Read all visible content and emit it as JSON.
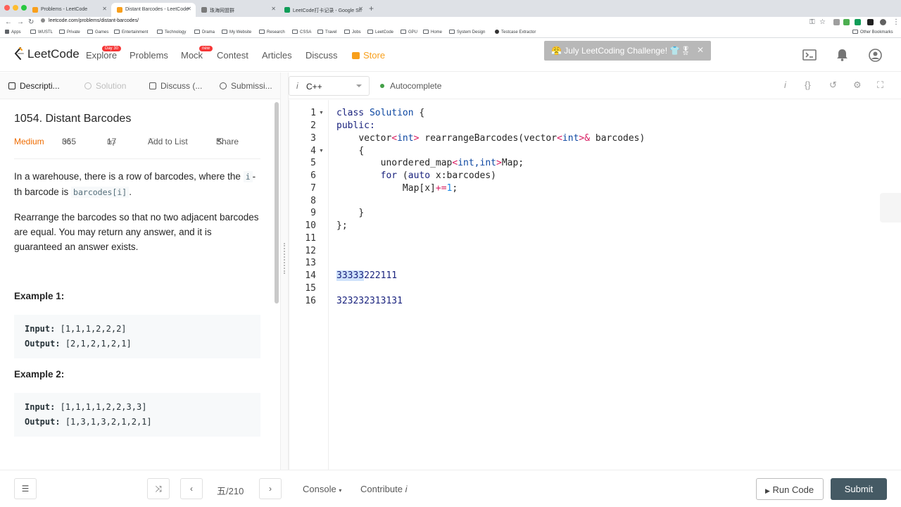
{
  "browser": {
    "tabs": [
      {
        "title": "Problems - LeetCode",
        "color": "#f89f1b"
      },
      {
        "title": "Distant Barcodes - LeetCode",
        "color": "#f89f1b"
      },
      {
        "title": "珠海网盟群",
        "color": "#7a7a7a"
      },
      {
        "title": "LeetCode打卡记录 - Google Sh",
        "color": "#0f9d58"
      }
    ],
    "url": "leetcode.com/problems/distant-barcodes/",
    "bookmarks": [
      "Apps",
      "WUSTL",
      "Private",
      "Games",
      "Entertainment",
      "Technology",
      "Drama",
      "My Website",
      "Research",
      "CSSA",
      "Travel",
      "Jobs",
      "LeetCode",
      "GPU",
      "Home",
      "System Design",
      "Testcase Extractor"
    ],
    "other_bookmarks": "Other Bookmarks"
  },
  "nav": {
    "logo": "LeetCode",
    "explore": "Explore",
    "explore_badge": "Day 30",
    "problems": "Problems",
    "mock": "Mock",
    "mock_badge": "new",
    "contest": "Contest",
    "articles": "Articles",
    "discuss": "Discuss",
    "store": "Store",
    "challenge": "July LeetCoding Challenge!",
    "challenge_emoji": "😤",
    "challenge_gifts": "👕🎖",
    "challenge_close": "✕"
  },
  "left_tabs": {
    "description": "Descripti...",
    "solution": "Solution",
    "discuss": "Discuss (...",
    "submissions": "Submissi..."
  },
  "problem": {
    "title": "1054. Distant Barcodes",
    "difficulty": "Medium",
    "likes": "365",
    "dislikes": "17",
    "add_to_list": "Add to List",
    "share": "Share",
    "p1_a": "In a warehouse, there is a row of barcodes, where the ",
    "p1_code1": "i",
    "p1_b": "-th barcode is ",
    "p1_code2": "barcodes[i]",
    "p1_c": ".",
    "p2": "Rearrange the barcodes so that no two adjacent barcodes are equal.  You may return any answer, and it is guaranteed an answer exists.",
    "example1_title": "Example 1:",
    "example1_input_label": "Input:",
    "example1_input": "[1,1,1,2,2,2]",
    "example1_output_label": "Output:",
    "example1_output": "[2,1,2,1,2,1]",
    "example2_title": "Example 2:",
    "example2_input_label": "Input:",
    "example2_input": "[1,1,1,1,2,2,3,3]",
    "example2_output_label": "Output:",
    "example2_output": "[1,3,1,3,2,1,2,1]"
  },
  "editor": {
    "language": "C++",
    "autocomplete": "Autocomplete",
    "line_numbers": [
      "1",
      "2",
      "3",
      "4",
      "5",
      "6",
      "7",
      "8",
      "9",
      "10",
      "11",
      "12",
      "13",
      "14",
      "15",
      "16"
    ],
    "l1_kw": "class",
    "l1_name": "Solution",
    "l1_rest": " {",
    "l2": "public:",
    "l3_a": "vector",
    "l3_b": "<",
    "l3_c": "int",
    "l3_d": ">",
    "l3_e": " rearrangeBarcodes(vector",
    "l3_f": "<",
    "l3_g": "int",
    "l3_h": ">&",
    "l3_i": " barcodes)",
    "l4": "{",
    "l5_a": "unordered_map",
    "l5_b": "<",
    "l5_c": "int,int",
    "l5_d": ">",
    "l5_e": "Map;",
    "l6_a": "for",
    "l6_b": " (",
    "l6_c": "auto",
    "l6_d": " x:barcodes)",
    "l7_a": "Map[x]",
    "l7_b": "+=",
    "l7_c": "1",
    "l7_d": ";",
    "l9": "}",
    "l10": "};",
    "l14_sel": "33333",
    "l14_rest": "222111",
    "l16": "323232313131"
  },
  "bottom": {
    "pager": "五/210",
    "console": "Console",
    "contribute": "Contribute",
    "run_code": "Run Code",
    "submit": "Submit"
  }
}
